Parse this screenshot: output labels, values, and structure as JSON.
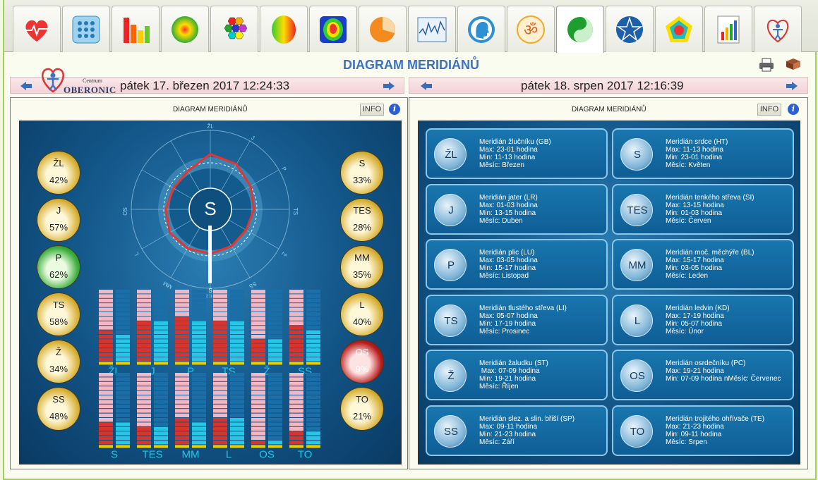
{
  "tabs": [
    {
      "icon": "heart-pulse-icon"
    },
    {
      "icon": "grid-dots-icon"
    },
    {
      "icon": "bar-chart-icon"
    },
    {
      "icon": "radial-glow-icon"
    },
    {
      "icon": "hexagons-icon"
    },
    {
      "icon": "brain-icon"
    },
    {
      "icon": "aura-icon"
    },
    {
      "icon": "pie-chart-icon"
    },
    {
      "icon": "wave-chart-icon"
    },
    {
      "icon": "head-profile-icon"
    },
    {
      "icon": "om-icon"
    },
    {
      "icon": "yin-yang-icon",
      "active": true
    },
    {
      "icon": "star-icon"
    },
    {
      "icon": "pentagon-icon"
    },
    {
      "icon": "report-chart-icon"
    },
    {
      "icon": "oberonic-logo-icon"
    }
  ],
  "page_title": "DIAGRAM MERIDIÁNŮ",
  "logo": {
    "small": "Centrum",
    "name": "OBERONIC"
  },
  "left_date": "pátek 17. březen 2017 12:24:33",
  "right_date": "pátek 18. srpen 2017 12:16:39",
  "left_panel": {
    "title": "DIAGRAM MERIDIÁNŮ",
    "info": "INFO",
    "i": "i"
  },
  "right_panel": {
    "title": "DIAGRAM MERIDIÁNŮ",
    "info": "INFO",
    "i": "i"
  },
  "left_balls": [
    {
      "label": "ŽL",
      "pct": "42%",
      "color": "gold"
    },
    {
      "label": "J",
      "pct": "57%",
      "color": "gold"
    },
    {
      "label": "P",
      "pct": "62%",
      "color": "green"
    },
    {
      "label": "TS",
      "pct": "58%",
      "color": "gold"
    },
    {
      "label": "Ž",
      "pct": "34%",
      "color": "gold"
    },
    {
      "label": "SS",
      "pct": "48%",
      "color": "gold"
    }
  ],
  "right_balls": [
    {
      "label": "S",
      "pct": "33%",
      "color": "gold"
    },
    {
      "label": "TES",
      "pct": "28%",
      "color": "gold"
    },
    {
      "label": "MM",
      "pct": "35%",
      "color": "gold"
    },
    {
      "label": "L",
      "pct": "40%",
      "color": "gold"
    },
    {
      "label": "OS",
      "pct": "9%",
      "color": "red"
    },
    {
      "label": "TO",
      "pct": "21%",
      "color": "gold"
    }
  ],
  "wheel": {
    "center": "S",
    "bottom": "S",
    "labels": [
      "ŽL",
      "J",
      "P",
      "TS",
      "Ž",
      "SS",
      "TES",
      "MM",
      "L",
      "OS"
    ]
  },
  "bars_top": {
    "labels": [
      "ŽL",
      "J",
      "P",
      "TS",
      "Ž",
      "SS"
    ],
    "left_values": [
      0.42,
      0.57,
      0.62,
      0.58,
      0.34,
      0.48
    ],
    "right_values": [
      0.38,
      0.54,
      0.58,
      0.55,
      0.31,
      0.45
    ]
  },
  "bars_bottom": {
    "labels": [
      "S",
      "TES",
      "MM",
      "L",
      "OS",
      "TO"
    ],
    "left_values": [
      0.33,
      0.28,
      0.35,
      0.4,
      0.09,
      0.21
    ],
    "right_values": [
      0.3,
      0.25,
      0.32,
      0.37,
      0.07,
      0.19
    ]
  },
  "cards": [
    {
      "sym": "ŽL",
      "lines": [
        "Meridián žlučníku (GB)",
        "Max: 23-01 hodina",
        "Min: 11-13 hodina",
        "Měsíc: Březen"
      ]
    },
    {
      "sym": "S",
      "lines": [
        "Meridián srdce (HT)",
        "Max: 11-13 hodina",
        "Min: 23-01 hodina",
        "Měsíc: Květen"
      ]
    },
    {
      "sym": "J",
      "lines": [
        "Meridián jater (LR)",
        "Max: 01-03 hodina",
        "Min: 13-15 hodina",
        "Měsíc: Duben"
      ]
    },
    {
      "sym": "TES",
      "lines": [
        "Meridián tenkého střeva (SI)",
        "Max: 13-15 hodina",
        "Min: 01-03 hodina",
        "Měsíc: Červen"
      ]
    },
    {
      "sym": "P",
      "lines": [
        "Meridián plic (LU)",
        "Max: 03-05 hodina",
        "Min: 15-17 hodina",
        "Měsíc: Listopad"
      ]
    },
    {
      "sym": "MM",
      "lines": [
        "Meridián moč. měchýře (BL)",
        "Max: 15-17 hodina",
        "Min: 03-05 hodina",
        "Měsíc: Leden"
      ]
    },
    {
      "sym": "TS",
      "lines": [
        "Meridián tlustého střeva (LI)",
        "Max: 05-07 hodina",
        "Min: 17-19 hodina",
        "Měsíc: Prosinec"
      ]
    },
    {
      "sym": "L",
      "lines": [
        "Meridián ledvin (KD)",
        "Max: 17-19 hodina",
        "Min: 05-07 hodina",
        "Měsíc: Únor"
      ]
    },
    {
      "sym": "Ž",
      "lines": [
        "Meridián žaludku (ST)",
        " Max: 07-09 hodina",
        "Min: 19-21 hodina",
        "Měsíc: Říjen"
      ]
    },
    {
      "sym": "OS",
      "lines": [
        "Meridián osrdečníku (PC)",
        "Max: 19-21 hodina",
        "Min: 07-09 hodina nMěsíc: Červenec",
        ""
      ]
    },
    {
      "sym": "SS",
      "lines": [
        "Meridián slez. a slin. břiší (SP)",
        "Max: 09-11 hodina",
        "Min: 21-23 hodina",
        "Měsíc: Září"
      ]
    },
    {
      "sym": "TO",
      "lines": [
        "Meridián trojitého ohřívače (TE)",
        "Max: 21-23 hodina",
        "Min: 09-11 hodina",
        "Měsíc: Srpen"
      ]
    }
  ],
  "colors": {
    "accent": "#3a73c4",
    "pink": "#f4b6c2",
    "red": "#d9342b",
    "cyan": "#25c6e6",
    "gold": "#c9a227",
    "green": "#2f9a2f",
    "yellow": "#e8d000"
  }
}
